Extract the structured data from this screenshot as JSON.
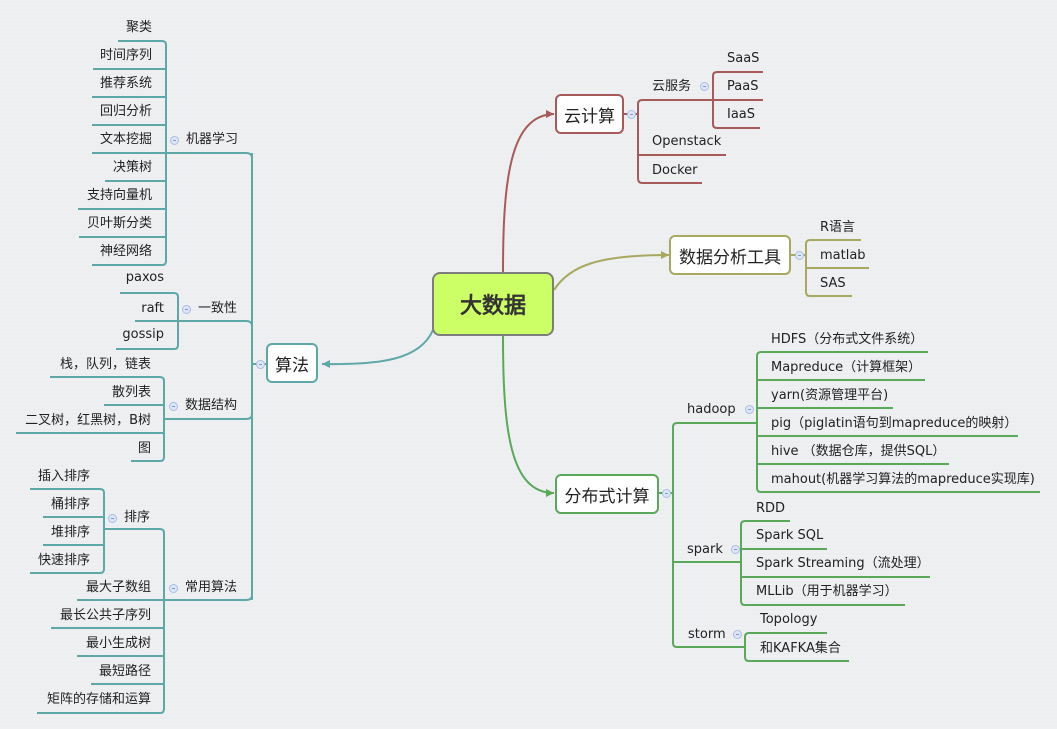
{
  "colors": {
    "algo": "#5fa8a8",
    "cloud": "#a85a5a",
    "tools": "#a8a860",
    "dist": "#5aa85a",
    "root_fill": "#ccff66"
  },
  "root": "大数据",
  "algo": {
    "label": "算法",
    "ml": {
      "label": "机器学习",
      "items": [
        "聚类",
        "时间序列",
        "推荐系统",
        "回归分析",
        "文本挖掘",
        "决策树",
        "支持向量机",
        "贝叶斯分类",
        "神经网络"
      ]
    },
    "consistency": {
      "label": "一致性",
      "items": [
        "paxos",
        "raft",
        "gossip"
      ]
    },
    "ds": {
      "label": "数据结构",
      "items": [
        "栈，队列，链表",
        "散列表",
        "二叉树，红黑树，B树",
        "图"
      ]
    },
    "common": {
      "label": "常用算法",
      "sort": {
        "label": "排序",
        "items": [
          "插入排序",
          "桶排序",
          "堆排序",
          "快速排序"
        ]
      },
      "items": [
        "最大子数组",
        "最长公共子序列",
        "最小生成树",
        "最短路径",
        "矩阵的存储和运算"
      ]
    }
  },
  "cloud": {
    "label": "云计算",
    "service": {
      "label": "云服务",
      "items": [
        "SaaS",
        "PaaS",
        "IaaS"
      ]
    },
    "items": [
      "Openstack",
      "Docker"
    ]
  },
  "tools": {
    "label": "数据分析工具",
    "items": [
      "R语言",
      "matlab",
      "SAS"
    ]
  },
  "dist": {
    "label": "分布式计算",
    "hadoop": {
      "label": "hadoop",
      "items": [
        "HDFS（分布式文件系统）",
        "Mapreduce（计算框架）",
        "yarn(资源管理平台)",
        "pig（piglatin语句到mapreduce的映射）",
        "hive （数据仓库，提供SQL）",
        "mahout(机器学习算法的mapreduce实现库)"
      ]
    },
    "spark": {
      "label": "spark",
      "items": [
        "RDD",
        "Spark SQL",
        "Spark Streaming（流处理）",
        "MLLib（用于机器学习）"
      ]
    },
    "storm": {
      "label": "storm",
      "items": [
        "Topology",
        "和KAFKA集合"
      ]
    }
  }
}
